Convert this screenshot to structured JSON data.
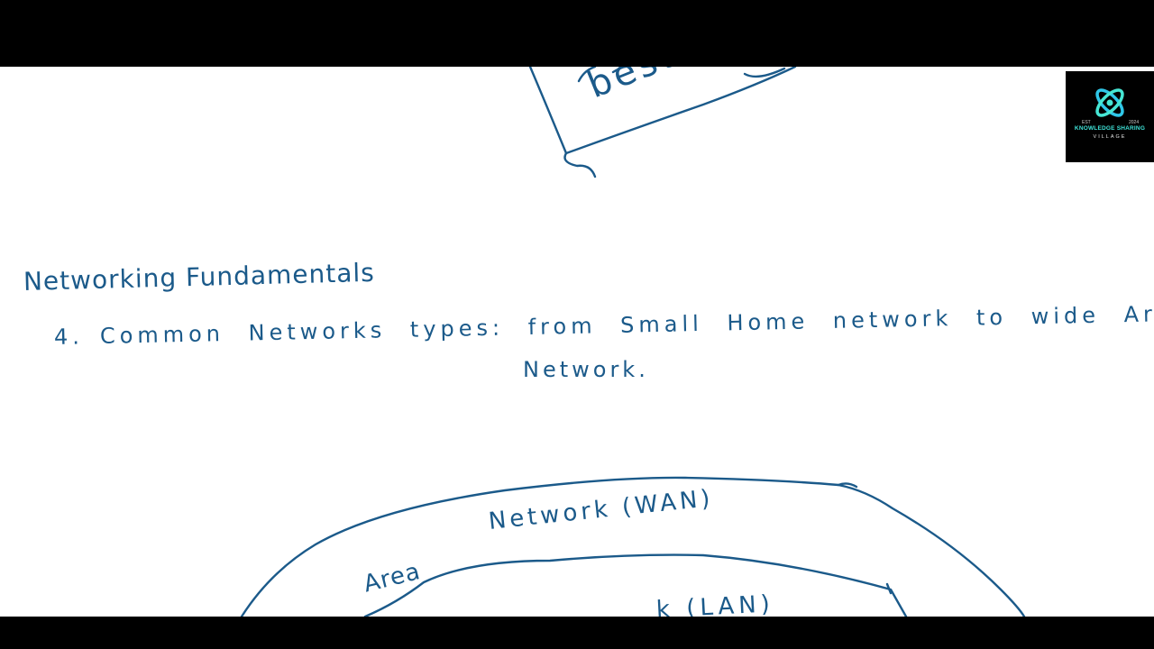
{
  "whiteboard": {
    "ink_color": "#1b5a8a",
    "background_color": "#ffffff",
    "fragment_top": "best",
    "heading": "Networking Fundamentals",
    "item_number": "4.",
    "item_text_line1": "Common Networks types: from Small Home network to wide Area",
    "item_text_line2": "Network.",
    "diagram": {
      "outer_label_area": "Area",
      "outer_label_wan": "Network (WAN)",
      "inner_label_lan": "k (LAN)"
    }
  },
  "logo": {
    "est_left": "EST",
    "est_right": "2024",
    "name": "KNOWLEDGE SHARING",
    "subtitle": "VILLAGE",
    "accent_color": "#3fe3d8",
    "icon": "atom-orbit-icon"
  }
}
